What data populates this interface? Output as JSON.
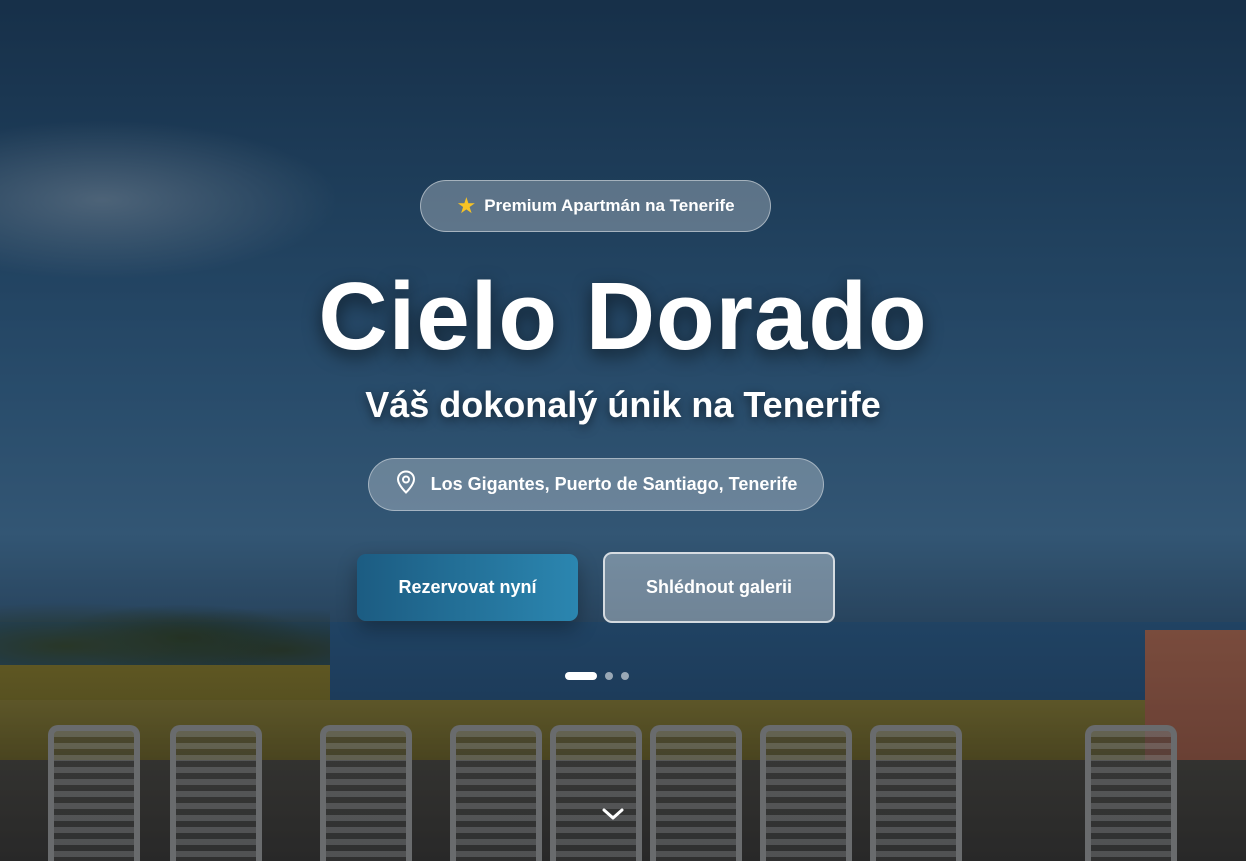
{
  "hero": {
    "badge": {
      "icon": "star-icon",
      "label": "Premium Apartmán na Tenerife"
    },
    "title": "Cielo Dorado",
    "subtitle": "Váš dokonalý únik na Tenerife",
    "location": {
      "icon": "map-pin-icon",
      "label": "Los Gigantes, Puerto de Santiago, Tenerife"
    },
    "buttons": {
      "book": "Rezervovat nyní",
      "gallery": "Shlédnout galerii"
    },
    "slider": {
      "count": 3,
      "active_index": 0
    },
    "scroll_icon": "chevron-down-icon"
  },
  "colors": {
    "accent_start": "#1c5c82",
    "accent_end": "#2b86b0",
    "star": "#f7c325",
    "text": "#ffffff"
  }
}
